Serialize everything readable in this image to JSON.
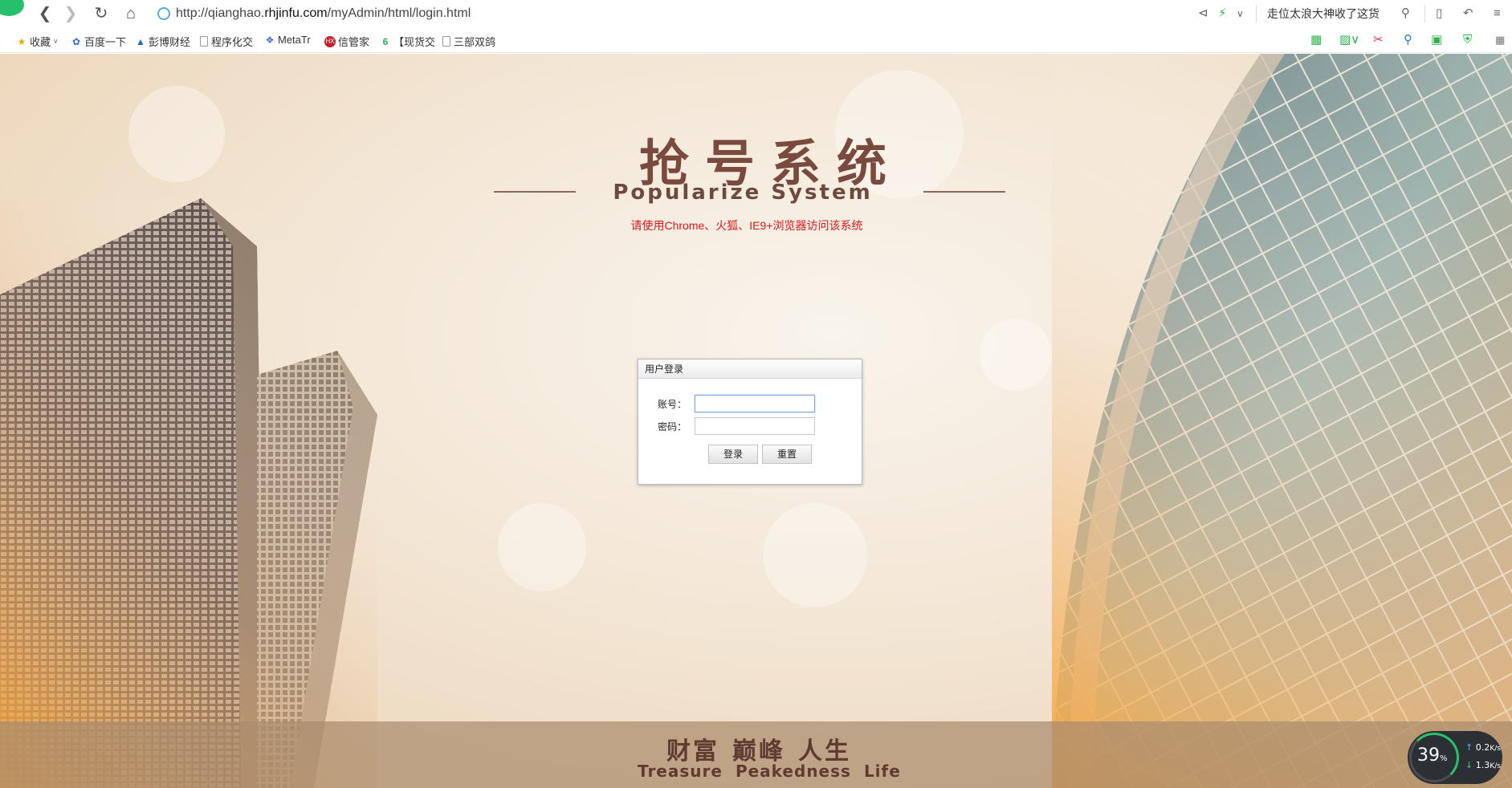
{
  "browser": {
    "url_prefix": "http://qianghao.",
    "url_domain": "rhjinfu.com",
    "url_path": "/myAdmin/html/login.html",
    "hot_search": "走位太浪大神收了这货"
  },
  "bookmarks": [
    {
      "label": "收藏",
      "icon": "star-icon"
    },
    {
      "label": "百度一下",
      "icon": "baidu-paw-icon"
    },
    {
      "label": "彭博财经",
      "icon": "bloomberg-icon"
    },
    {
      "label": "程序化交",
      "icon": "page-icon"
    },
    {
      "label": "MetaTr",
      "icon": "metatrader-icon"
    },
    {
      "label": "信管家",
      "icon": "xinguanjia-icon"
    },
    {
      "label": "【现货交",
      "icon": "six-icon"
    },
    {
      "label": "三部双鸽",
      "icon": "page-icon"
    }
  ],
  "hero": {
    "title_cn": "抢号系统",
    "title_en": "Popularize System",
    "browser_note": "请使用Chrome、火狐、IE9+浏览器访问该系统"
  },
  "login": {
    "header": "用户登录",
    "account_label": "账号：",
    "password_label": "密码：",
    "account_value": "",
    "password_value": "",
    "login_button": "登录",
    "reset_button": "重置"
  },
  "footer": {
    "slogan_cn": [
      "财富",
      "巅峰",
      "人生"
    ],
    "slogan_en": [
      "Treasure",
      "Peakedness",
      "Life"
    ]
  },
  "network_widget": {
    "percent": "39",
    "percent_unit": "%",
    "upload": "0.2",
    "upload_unit": "K/s",
    "download": "1.3",
    "download_unit": "K/s"
  },
  "colors": {
    "title": "#7a4a3e",
    "note": "#e4151a",
    "footer_band": "#aa8c6e",
    "accent_green": "#27c36c"
  }
}
